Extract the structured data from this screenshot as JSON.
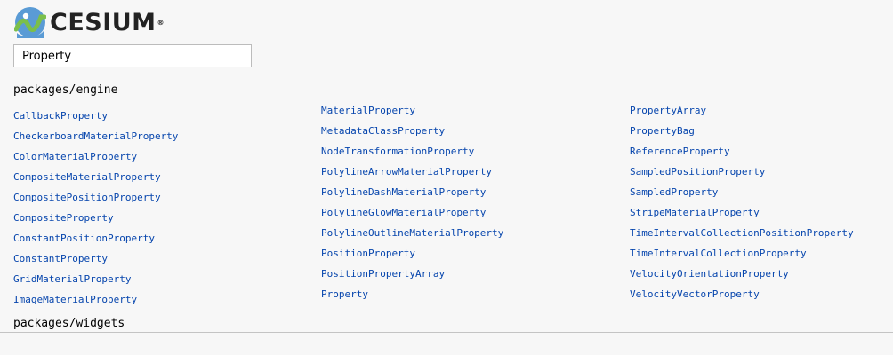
{
  "logo": {
    "text": "CESIUM",
    "registered_mark": "®",
    "colors": {
      "mark_circle": "#5a9bd5",
      "mark_wave": "#7bbf4b"
    }
  },
  "search": {
    "value": "Property",
    "placeholder": ""
  },
  "sections": [
    {
      "title": "packages/engine",
      "columns": [
        [
          "CallbackProperty",
          "CheckerboardMaterialProperty",
          "ColorMaterialProperty",
          "CompositeMaterialProperty",
          "CompositePositionProperty",
          "CompositeProperty",
          "ConstantPositionProperty",
          "ConstantProperty",
          "GridMaterialProperty",
          "ImageMaterialProperty"
        ],
        [
          "MaterialProperty",
          "MetadataClassProperty",
          "NodeTransformationProperty",
          "PolylineArrowMaterialProperty",
          "PolylineDashMaterialProperty",
          "PolylineGlowMaterialProperty",
          "PolylineOutlineMaterialProperty",
          "PositionProperty",
          "PositionPropertyArray",
          "Property"
        ],
        [
          "PropertyArray",
          "PropertyBag",
          "ReferenceProperty",
          "SampledPositionProperty",
          "SampledProperty",
          "StripeMaterialProperty",
          "TimeIntervalCollectionPositionProperty",
          "TimeIntervalCollectionProperty",
          "VelocityOrientationProperty",
          "VelocityVectorProperty"
        ]
      ]
    },
    {
      "title": "packages/widgets",
      "columns": []
    }
  ],
  "colors": {
    "link": "#0645ad",
    "background": "#f7f7f7"
  }
}
